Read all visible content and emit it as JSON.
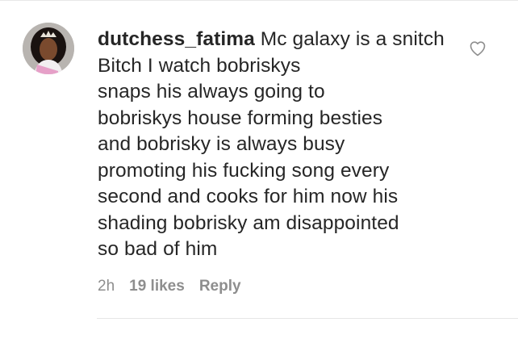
{
  "comment": {
    "username": "dutchess_fatima",
    "text": "Mc galaxy is a snitch Bitch I watch bobriskys\nsnaps his always going to\nbobriskys house forming besties\nand bobrisky is always busy\npromoting  his fucking song every\nsecond and cooks for him now his\nshading bobrisky am disappointed\nso bad of him",
    "time": "2h",
    "likes": "19 likes",
    "reply_label": "Reply"
  },
  "icons": {
    "like": "heart-outline-icon",
    "avatar": "profile-photo"
  },
  "colors": {
    "text": "#262626",
    "meta": "#8e8e8e",
    "divider": "#e6e6e6"
  }
}
